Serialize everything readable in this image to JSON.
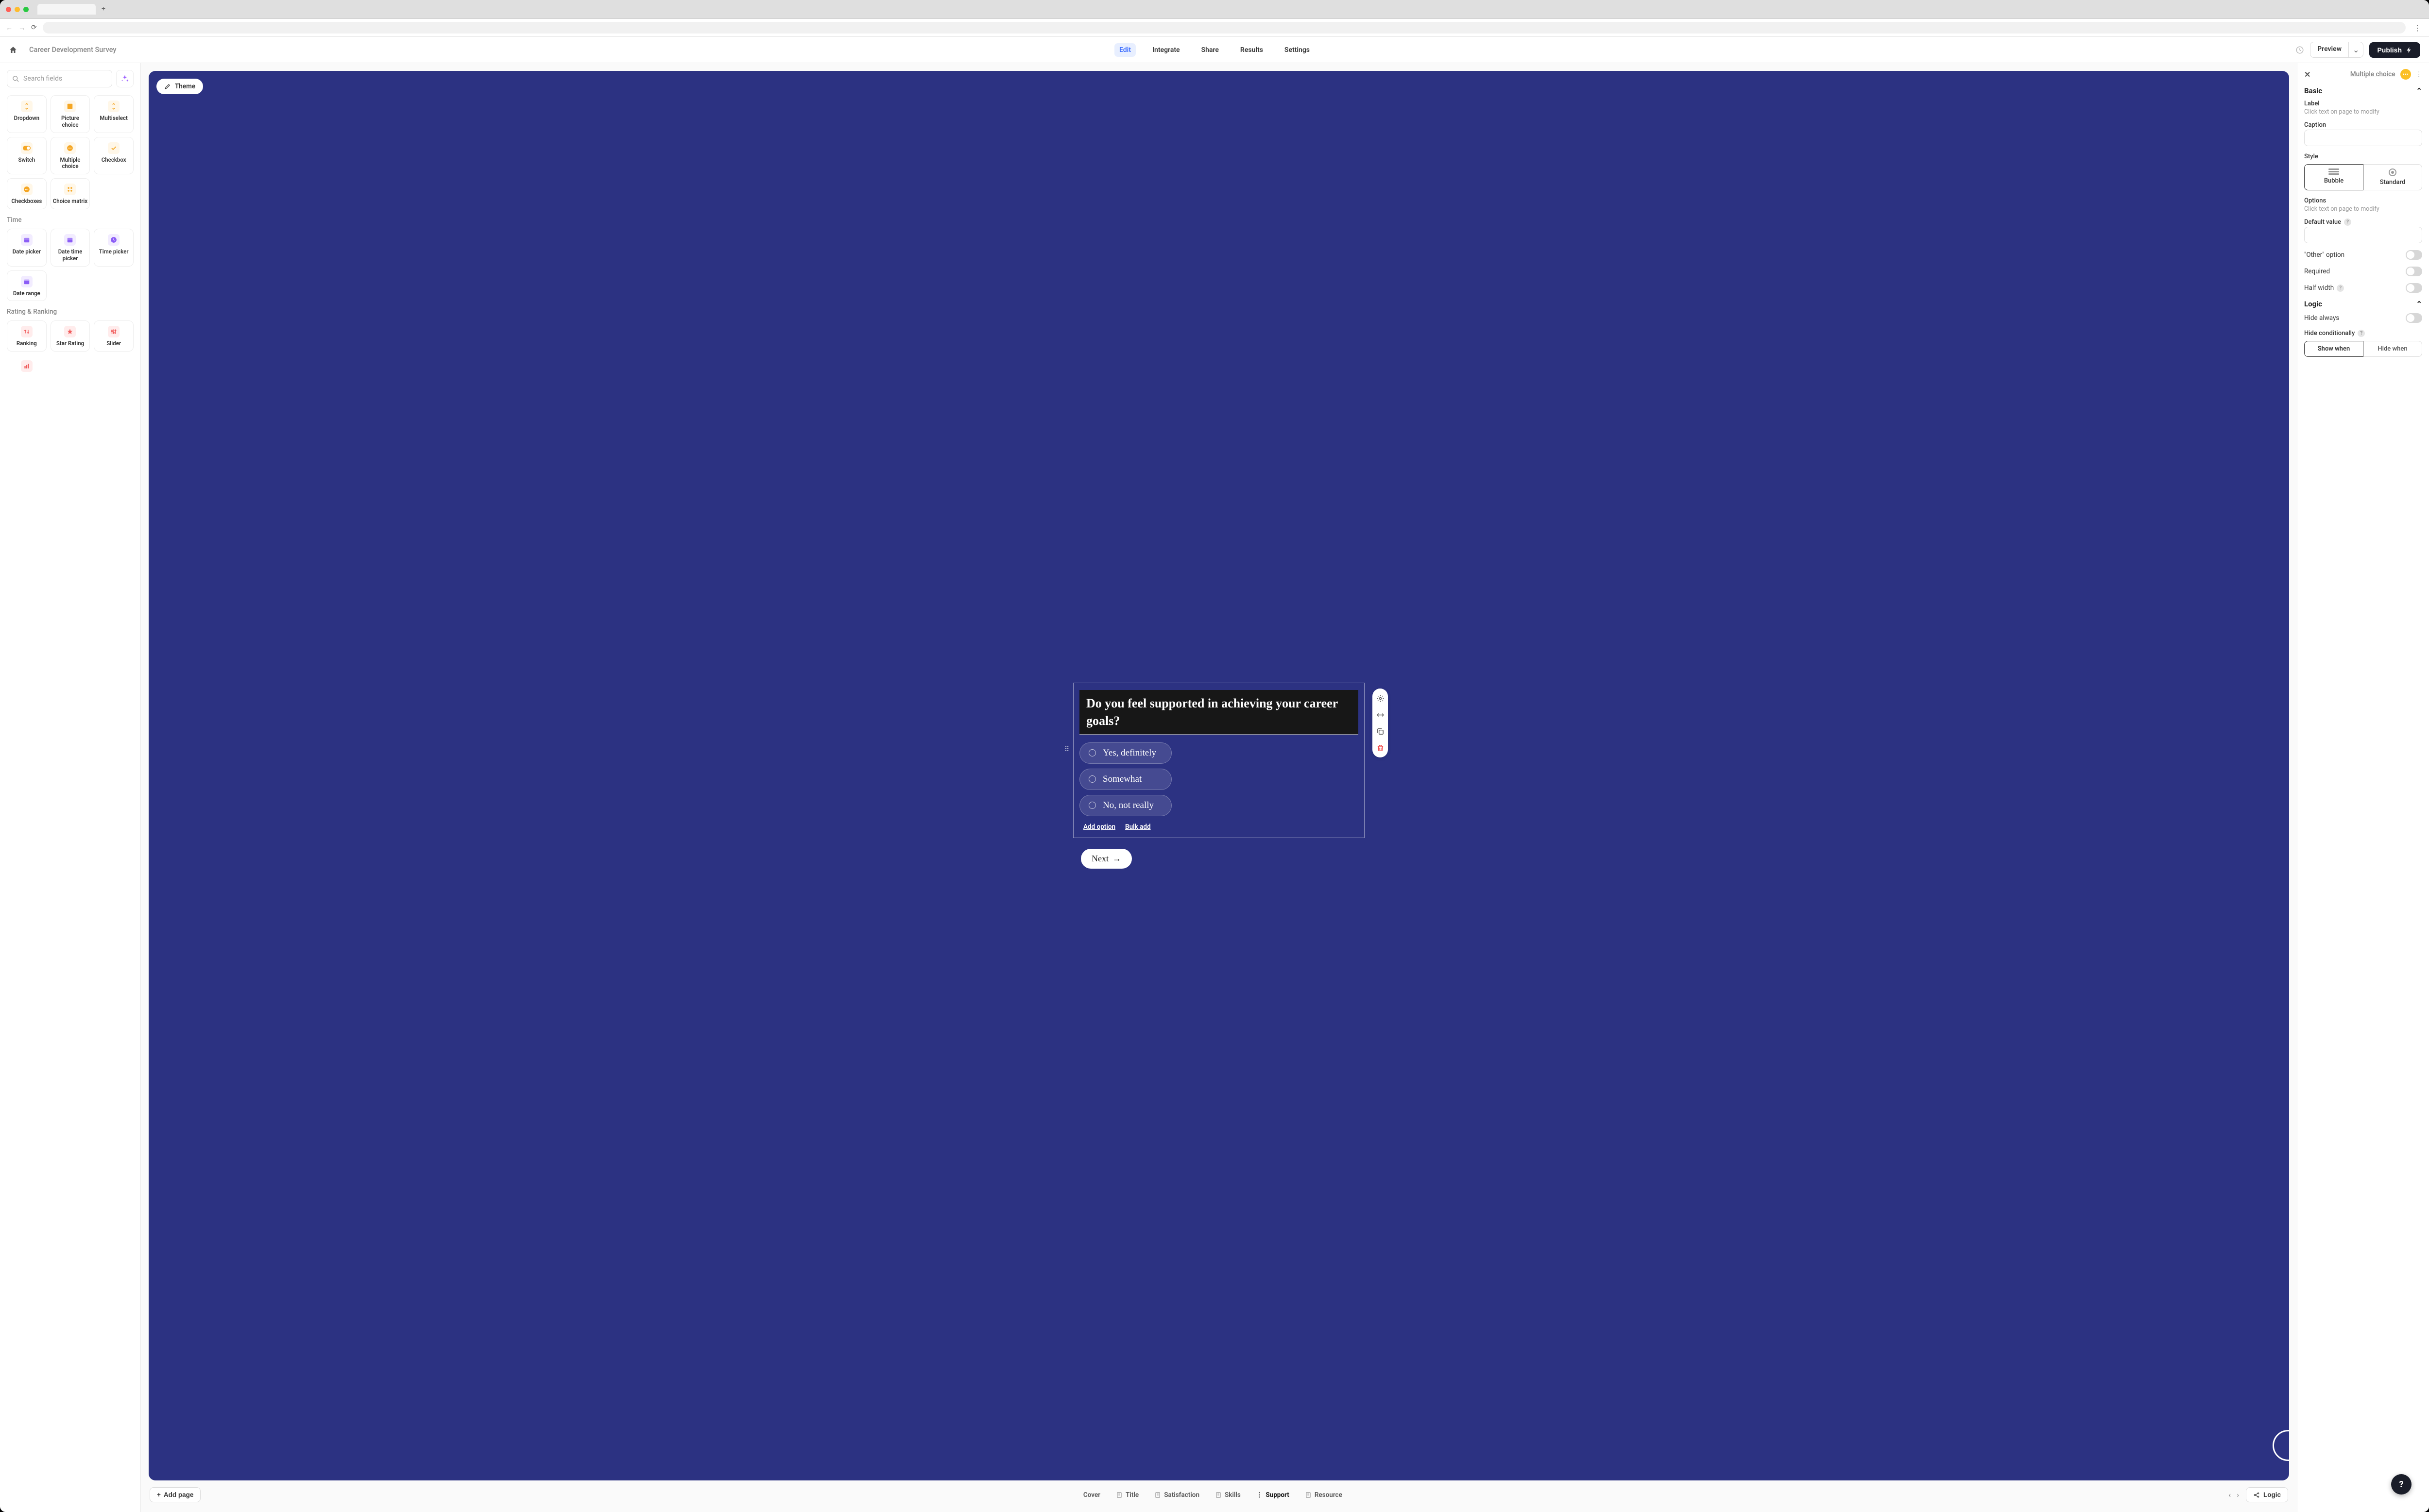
{
  "header": {
    "page_title": "Career Development Survey",
    "nav": {
      "edit": "Edit",
      "integrate": "Integrate",
      "share": "Share",
      "results": "Results",
      "settings": "Settings"
    },
    "preview_label": "Preview",
    "publish_label": "Publish"
  },
  "left": {
    "search_placeholder": "Search fields",
    "fields_choice": [
      {
        "label": "Dropdown"
      },
      {
        "label": "Picture choice"
      },
      {
        "label": "Multiselect"
      },
      {
        "label": "Switch"
      },
      {
        "label": "Multiple choice"
      },
      {
        "label": "Checkbox"
      },
      {
        "label": "Checkboxes"
      },
      {
        "label": "Choice matrix"
      }
    ],
    "section_time": "Time",
    "fields_time": [
      {
        "label": "Date picker"
      },
      {
        "label": "Date time picker"
      },
      {
        "label": "Time picker"
      },
      {
        "label": "Date range"
      }
    ],
    "section_rating": "Rating & Ranking",
    "fields_rating": [
      {
        "label": "Ranking"
      },
      {
        "label": "Star Rating"
      },
      {
        "label": "Slider"
      }
    ]
  },
  "canvas": {
    "theme_label": "Theme",
    "question_title": "Do you feel supported in achieving your career goals?",
    "options": [
      "Yes, definitely",
      "Somewhat",
      "No, not really"
    ],
    "add_option": "Add option",
    "bulk_add": "Bulk add",
    "next_label": "Next"
  },
  "page_bar": {
    "add_page": "Add page",
    "tabs": [
      {
        "label": "Cover",
        "icon": "none"
      },
      {
        "label": "Title",
        "icon": "page"
      },
      {
        "label": "Satisfaction",
        "icon": "page"
      },
      {
        "label": "Skills",
        "icon": "page"
      },
      {
        "label": "Support",
        "icon": "dots",
        "active": true
      },
      {
        "label": "Resource",
        "icon": "page"
      }
    ],
    "logic_label": "Logic"
  },
  "right": {
    "field_type": "Multiple choice",
    "section_basic": "Basic",
    "label_label": "Label",
    "label_help": "Click text on page to modify",
    "caption_label": "Caption",
    "style_label": "Style",
    "style_bubble": "Bubble",
    "style_standard": "Standard",
    "options_label": "Options",
    "options_help": "Click text on page to modify",
    "default_value_label": "Default value",
    "other_option_label": "\"Other\" option",
    "required_label": "Required",
    "half_width_label": "Half width",
    "section_logic": "Logic",
    "hide_always_label": "Hide always",
    "hide_conditionally_label": "Hide conditionally",
    "show_when": "Show when",
    "hide_when": "Hide when"
  }
}
